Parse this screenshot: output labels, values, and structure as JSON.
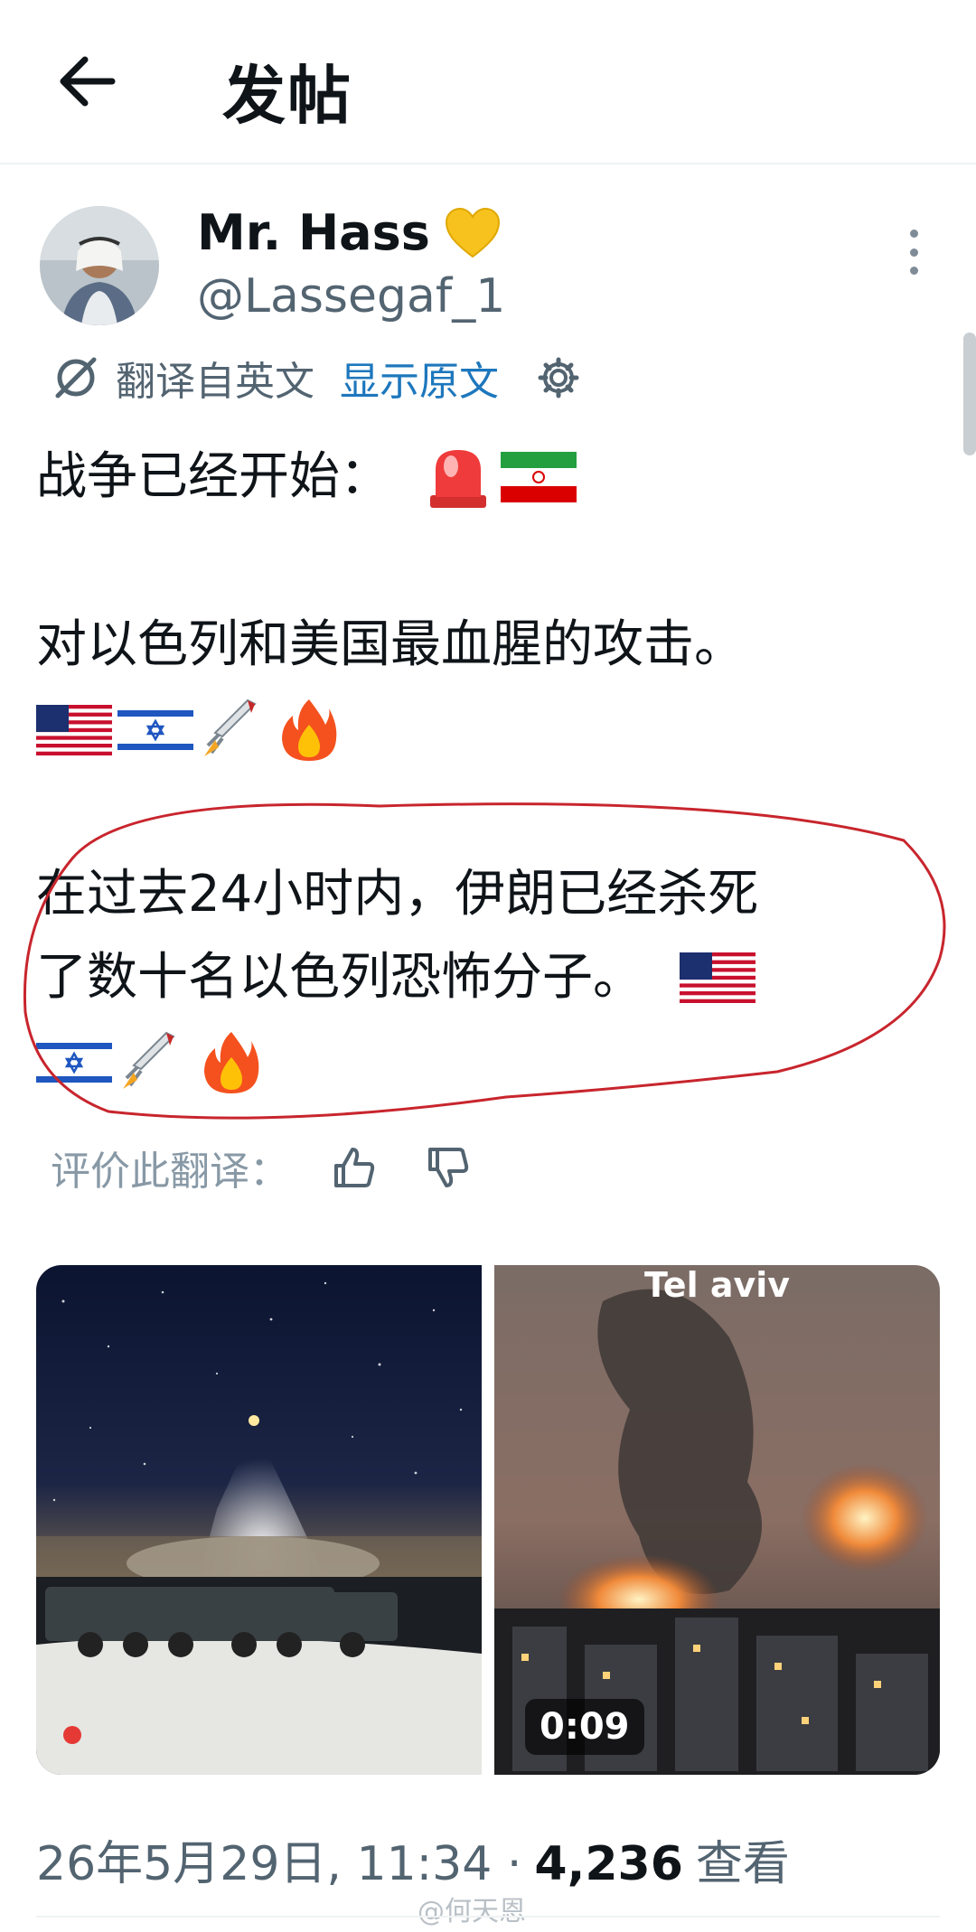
{
  "header": {
    "title": "发帖"
  },
  "author": {
    "display_name": "Mr. Hass",
    "handle": "@Lassegaf_1"
  },
  "translation": {
    "label": "翻译自英文",
    "show_original": "显示原文"
  },
  "tweet": {
    "line1": "战争已经开始：",
    "line2": "对以色列和美国最血腥的攻击。",
    "line3": "在过去24小时内，伊朗已经杀死",
    "line4": "了数十名以色列恐怖分子。"
  },
  "rate_translation": {
    "label": "评价此翻译："
  },
  "media": {
    "video_caption": "Tel aviv",
    "duration": "0:09"
  },
  "footer": {
    "date_time": "26年5月29日, 11:34 ·",
    "views_count": "4,236",
    "views_label": "查看"
  },
  "watermark": "@何天恩",
  "colors": {
    "link_blue": "#1d77bd",
    "secondary_text": "#536471",
    "annotation_red": "#c8252d"
  },
  "icons": [
    "back-arrow-icon",
    "yellow-heart-icon",
    "more-vertical-icon",
    "translate-icon",
    "gear-icon",
    "siren-icon",
    "iran-flag-icon",
    "usa-flag-icon",
    "israel-flag-icon",
    "rocket-icon",
    "fire-icon",
    "thumbs-up-icon",
    "thumbs-down-icon"
  ]
}
